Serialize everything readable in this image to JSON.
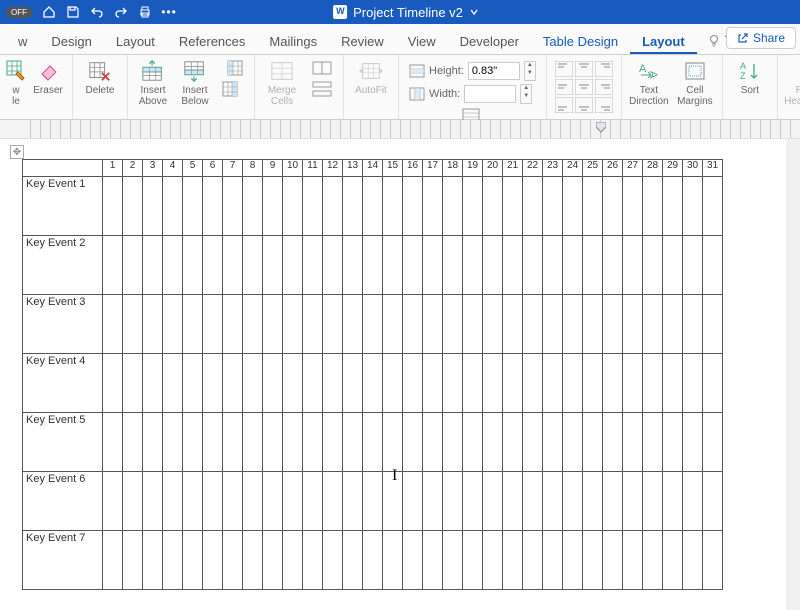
{
  "title": "Project Timeline v2",
  "autosave": "OFF",
  "tabs": [
    "w",
    "Design",
    "Layout",
    "References",
    "Mailings",
    "Review",
    "View",
    "Developer",
    "Table Design",
    "Layout"
  ],
  "active_tab_index": 9,
  "tell_me": "Tell me",
  "share": "Share",
  "ribbon": {
    "draw_le": "w\nle",
    "eraser": "Eraser",
    "delete": "Delete",
    "insert_above": "Insert\nAbove",
    "insert_below": "Insert\nBelow",
    "merge_cells": "Merge\nCells",
    "autofit": "AutoFit",
    "height_label": "Height:",
    "height_value": "0.83\"",
    "width_label": "Width:",
    "width_value": "",
    "text_direction": "Text\nDirection",
    "cell_margins": "Cell\nMargins",
    "sort": "Sort",
    "repeat_header": "Repeat\nHeader Row"
  },
  "table": {
    "days": [
      "1",
      "2",
      "3",
      "4",
      "5",
      "6",
      "7",
      "8",
      "9",
      "10",
      "11",
      "12",
      "13",
      "14",
      "15",
      "16",
      "17",
      "18",
      "19",
      "20",
      "21",
      "22",
      "23",
      "24",
      "25",
      "26",
      "27",
      "28",
      "29",
      "30",
      "31"
    ],
    "events": [
      "Key Event 1",
      "Key Event 2",
      "Key Event 3",
      "Key Event 4",
      "Key Event 5",
      "Key Event 6",
      "Key Event 7"
    ]
  }
}
